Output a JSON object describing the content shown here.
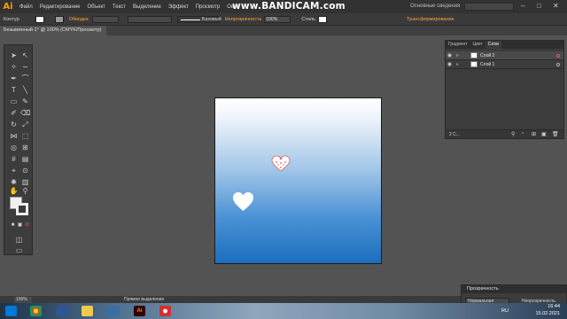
{
  "app": {
    "logo": "Ai"
  },
  "menu": [
    "Файл",
    "Редактирование",
    "Объект",
    "Текст",
    "Выделение",
    "Эффект",
    "Просмотр",
    "Окно"
  ],
  "watermark": "www.BANDICAM.com",
  "workspace": "Основные сведения",
  "control_bar": {
    "selection_label": "Контур",
    "stroke_label": "Обводка",
    "style_label": "Базовый",
    "opacity_label": "Непрозрачность",
    "opacity_value": "100%",
    "styles_label": "Стиль",
    "transform_label": "Трансформирование"
  },
  "document_tab": "Безымянный-1* @ 100% (CMYK/Просмотр)",
  "layers_panel": {
    "tabs": [
      "Градиент",
      "Цвет",
      "Слои"
    ],
    "active_tab": "Слои",
    "layers": [
      {
        "name": "Слой 2",
        "selected": true
      },
      {
        "name": "Слой 1",
        "selected": false
      }
    ],
    "count": "2 С..."
  },
  "transparency_panel": {
    "title": "Прозрачность",
    "blend_mode": "Нормальная",
    "opacity_label": "Непрозрачность"
  },
  "status": {
    "zoom": "100%",
    "tool_name": "Прямое выделение"
  },
  "taskbar": {
    "lang": "RU",
    "time": "16:44",
    "date": "15.02.2021"
  },
  "colors": {
    "app_accent": "#ff9a00",
    "gradient_top": "#ffffff",
    "gradient_bottom": "#1a6fbe",
    "heart_fill": "#ffffff",
    "selection_color": "#e05a5a"
  },
  "icons": [
    "selection-tool-icon",
    "direct-selection-tool-icon",
    "pen-tool-icon",
    "type-tool-icon",
    "hand-tool-icon",
    "zoom-tool-icon",
    "eye-icon",
    "lock-icon"
  ]
}
